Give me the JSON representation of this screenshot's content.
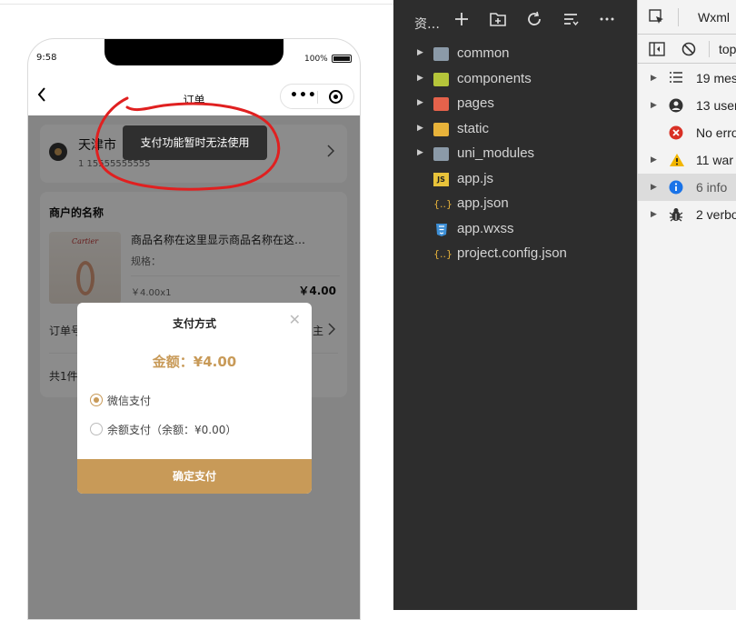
{
  "simulator": {
    "status": {
      "time": "9:58",
      "battery": "100%"
    },
    "nav": {
      "back_icon": "chevron-left-icon",
      "title": "订单"
    },
    "address": {
      "name": "天津市",
      "phone": "1 15555555555"
    },
    "order": {
      "shop_name": "商户的名称",
      "product": {
        "brand": "Cartier",
        "title": "商品名称在这里显示商品名称在这…",
        "spec": "规格：",
        "qty": "￥4.00x1",
        "price": "￥4.00"
      },
      "order_no_label": "订单号",
      "order_no_tail": "主",
      "total_label": "共1件"
    },
    "toast": "支付功能暂时无法使用",
    "payment": {
      "title": "支付方式",
      "amount": "金额：¥4.00",
      "options": [
        {
          "label": "微信支付",
          "selected": true
        },
        {
          "label": "余额支付（余额：¥0.00）",
          "selected": false
        }
      ],
      "confirm": "确定支付"
    },
    "annotation_color": "#e02020",
    "accent_color": "#c89a58"
  },
  "explorer": {
    "title": "资…",
    "toolbar_icons": [
      "plus-icon",
      "new-folder-icon",
      "refresh-icon",
      "collapse-icon",
      "more-icon"
    ],
    "items": [
      {
        "label": "common",
        "type": "folder",
        "icon": "folder-icon"
      },
      {
        "label": "components",
        "type": "folder",
        "icon": "components-folder-icon"
      },
      {
        "label": "pages",
        "type": "folder",
        "icon": "pages-folder-icon"
      },
      {
        "label": "static",
        "type": "folder",
        "icon": "static-folder-icon"
      },
      {
        "label": "uni_modules",
        "type": "folder",
        "icon": "folder-icon"
      },
      {
        "label": "app.js",
        "type": "file",
        "icon": "js-file-icon"
      },
      {
        "label": "app.json",
        "type": "file",
        "icon": "json-file-icon"
      },
      {
        "label": "app.wxss",
        "type": "file",
        "icon": "css-file-icon"
      },
      {
        "label": "project.config.json",
        "type": "file",
        "icon": "json-file-icon"
      }
    ]
  },
  "console": {
    "tab": "Wxml",
    "context": "top",
    "rows": [
      {
        "text": "19 mes",
        "icon": "list-icon"
      },
      {
        "text": "13 user",
        "icon": "user-icon"
      },
      {
        "text": "No erro",
        "icon": "error-icon"
      },
      {
        "text": "11 war",
        "icon": "warning-icon"
      },
      {
        "text": "6 info",
        "icon": "info-icon"
      },
      {
        "text": "2 verbo",
        "icon": "bug-icon"
      }
    ]
  }
}
